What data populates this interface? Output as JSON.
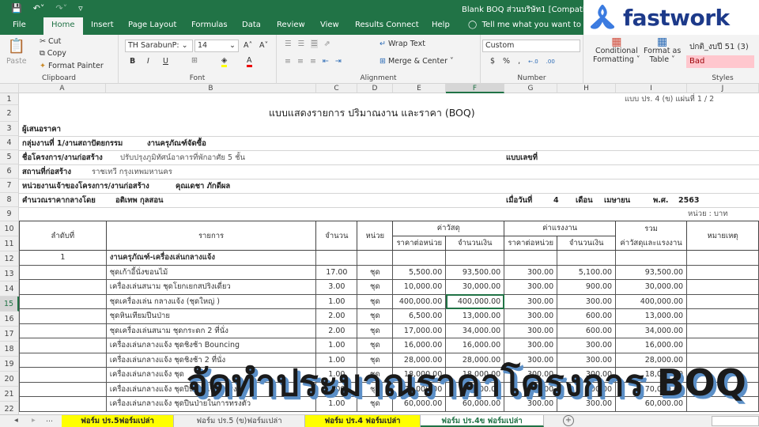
{
  "titlebar": {
    "qat_icons": [
      "save-icon",
      "undo-icon",
      "redo-icon",
      "customize-icon"
    ],
    "doc_title": "Blank BOQ ส่วนบริษัท1  [Compati"
  },
  "menu": {
    "tabs": [
      "File",
      "Home",
      "Insert",
      "Page Layout",
      "Formulas",
      "Data",
      "Review",
      "View",
      "Results Connect",
      "Help"
    ],
    "active": "Home",
    "tell_me": "Tell me what you want to"
  },
  "logo": {
    "text": "fastwork",
    "color": "#1d3a8a"
  },
  "ribbon": {
    "clipboard": {
      "paste": "Paste",
      "cut": "Cut",
      "copy": "Copy",
      "format_painter": "Format Painter",
      "label": "Clipboard"
    },
    "font": {
      "name": "TH SarabunP:",
      "size": "14",
      "grow": "A˄",
      "shrink": "A˅",
      "bold": "B",
      "italic": "I",
      "underline": "U",
      "label": "Font"
    },
    "alignment": {
      "wrap": "Wrap Text",
      "merge": "Merge & Center",
      "label": "Alignment"
    },
    "number": {
      "format": "Custom",
      "currency": "$",
      "percent": "%",
      "comma": ",",
      "inc": "←.0",
      "dec": ".00",
      "label": "Number"
    },
    "styles": {
      "cond": "Conditional",
      "cond2": "Formatting ˅",
      "fmt": "Format as",
      "fmt2": "Table ˅",
      "normal_style": "ปกติ_งบปี 51 (3)",
      "bad_style": "Bad",
      "label": "Styles"
    }
  },
  "sheet": {
    "columns": [
      "A",
      "B",
      "C",
      "D",
      "E",
      "F",
      "G",
      "H",
      "I",
      "J"
    ],
    "selected_column": "F",
    "rows": [
      "1",
      "2",
      "3",
      "4",
      "5",
      "6",
      "7",
      "8",
      "9",
      "10",
      "11",
      "12",
      "13",
      "14",
      "15",
      "16",
      "17",
      "18",
      "19",
      "20",
      "21",
      "22"
    ],
    "selected_row": "15",
    "form_ref": "แบบ ปร. 4 (ข)  แผ่นที่   1  /  2",
    "title": "แบบแสดงรายการ ปริมาณงาน และราคา (BOQ)",
    "bidder": "ผู้เสนอราคา",
    "group_label": "กลุ่มงานที่ 1/งานสถาปัตยกรรม",
    "group_value": "งานครุภัณฑ์จัดซื้อ",
    "project_label": "ชื่อโครงการ/งานก่อสร้าง",
    "project_value": "ปรับปรุงภูมิทัศน์อาคารที่พักอาศัย 5 ชั้น",
    "drawing_no": "แบบเลขที่",
    "site_label": "สถานที่ก่อสร้าง",
    "site_value": "ราชเทวี กรุงเทพมหานคร",
    "owner_label": "หน่วยงานเจ้าของโครงการ/งานก่อสร้าง",
    "owner_value": "คุณเดชา ภักดีผล",
    "calc_label": "คำนวณราคากลางโดย",
    "calc_value": "อติเทพ กุลสอน",
    "date_label": "เมื่อวันที่",
    "date_day": "4",
    "month_label": "เดือน",
    "month_value": "เมษายน",
    "year_label": "พ.ศ.",
    "year_value": "2563",
    "unit_note": "หน่วย : บาท"
  },
  "table": {
    "headers": {
      "seq": "ลำดับที่",
      "item": "รายการ",
      "qty": "จำนวน",
      "unit": "หน่วย",
      "material": "ค่าวัสดุ",
      "labor": "ค่าแรงงาน",
      "total": "รวม",
      "total2": "ค่าวัสดุและแรงงาน",
      "remark": "หมายเหตุ",
      "unit_price": "ราคาต่อหน่วย",
      "amount": "จำนวนเงิน"
    },
    "section": {
      "seq": "1",
      "title": "งานครุภัณฑ์-เครื่องเล่นกลางแจ้ง"
    },
    "rows": [
      {
        "item": "ชุดเก้าอี้นั่งขอนไม้",
        "qty": "17.00",
        "unit": "ชุด",
        "mat_price": "5,500.00",
        "mat_amount": "93,500.00",
        "lab_price": "300.00",
        "lab_amount": "5,100.00",
        "total": "93,500.00"
      },
      {
        "item": "เครื่องเล่นสนาม ชุดโยกเยกสปริงเดี่ยว",
        "qty": "3.00",
        "unit": "ชุด",
        "mat_price": "10,000.00",
        "mat_amount": "30,000.00",
        "lab_price": "300.00",
        "lab_amount": "900.00",
        "total": "30,000.00"
      },
      {
        "item": "ชุดเครื่องเล่น กลางแจ้ง (ชุดใหญ่ )",
        "qty": "1.00",
        "unit": "ชุด",
        "mat_price": "400,000.00",
        "mat_amount": "400,000.00",
        "lab_price": "300.00",
        "lab_amount": "300.00",
        "total": "400,000.00"
      },
      {
        "item": "ชุดหินเทียมปีนป่าย",
        "qty": "2.00",
        "unit": "ชุด",
        "mat_price": "6,500.00",
        "mat_amount": "13,000.00",
        "lab_price": "300.00",
        "lab_amount": "600.00",
        "total": "13,000.00"
      },
      {
        "item": "ชุดเครื่องเล่นสนาม ชุดกระดก 2 ที่นั่ง",
        "qty": "2.00",
        "unit": "ชุด",
        "mat_price": "17,000.00",
        "mat_amount": "34,000.00",
        "lab_price": "300.00",
        "lab_amount": "600.00",
        "total": "34,000.00"
      },
      {
        "item": "เครื่องเล่นกลางแจ้ง ชุดชิงช้า Bouncing",
        "qty": "1.00",
        "unit": "ชุด",
        "mat_price": "16,000.00",
        "mat_amount": "16,000.00",
        "lab_price": "300.00",
        "lab_amount": "300.00",
        "total": "16,000.00"
      },
      {
        "item": "เครื่องเล่นกลางแจ้ง ชุดชิงช้า 2 ที่นั่ง",
        "qty": "1.00",
        "unit": "ชุด",
        "mat_price": "28,000.00",
        "mat_amount": "28,000.00",
        "lab_price": "300.00",
        "lab_amount": "300.00",
        "total": "28,000.00"
      },
      {
        "item": "เครื่องเล่นกลางแจ้ง ชุด",
        "qty": "1.00",
        "unit": "ชุด",
        "mat_price": "18,000.00",
        "mat_amount": "18,000.00",
        "lab_price": "300.00",
        "lab_amount": "300.00",
        "total": "18,000.00"
      },
      {
        "item": "เครื่องเล่นกลางแจ้ง ชุดปีนป่ายเชือกทรง A",
        "qty": "1.00",
        "unit": "ชุด",
        "mat_price": "70,000.00",
        "mat_amount": "70,000.00",
        "lab_price": "300.00",
        "lab_amount": "300.00",
        "total": "70,000.00"
      },
      {
        "item": "เครื่องเล่นกลางแจ้ง ชุดปีนป่ายในการทรงตัว",
        "qty": "1.00",
        "unit": "ชุด",
        "mat_price": "60,000.00",
        "mat_amount": "60,000.00",
        "lab_price": "300.00",
        "lab_amount": "300.00",
        "total": "60,000.00"
      }
    ]
  },
  "overlay_text": "จัดทำประมาณราคาโครงการ BOQ",
  "sheet_tabs": [
    {
      "label": "ฟอร์ม ปร.5ฟอร์มเปล่า",
      "style": "y"
    },
    {
      "label": "ฟอร์ม ปร.5 (ข)ฟอร์มเปล่า",
      "style": "g"
    },
    {
      "label": "ฟอร์ม ปร.4 ฟอร์มเปล่า",
      "style": "y"
    },
    {
      "label": "ฟอร์ม ปร.4ข ฟอร์มเปล่า",
      "style": "act"
    }
  ],
  "tab_nav": {
    "prev": "◂",
    "next": "▸",
    "more": "...",
    "add": "+"
  }
}
